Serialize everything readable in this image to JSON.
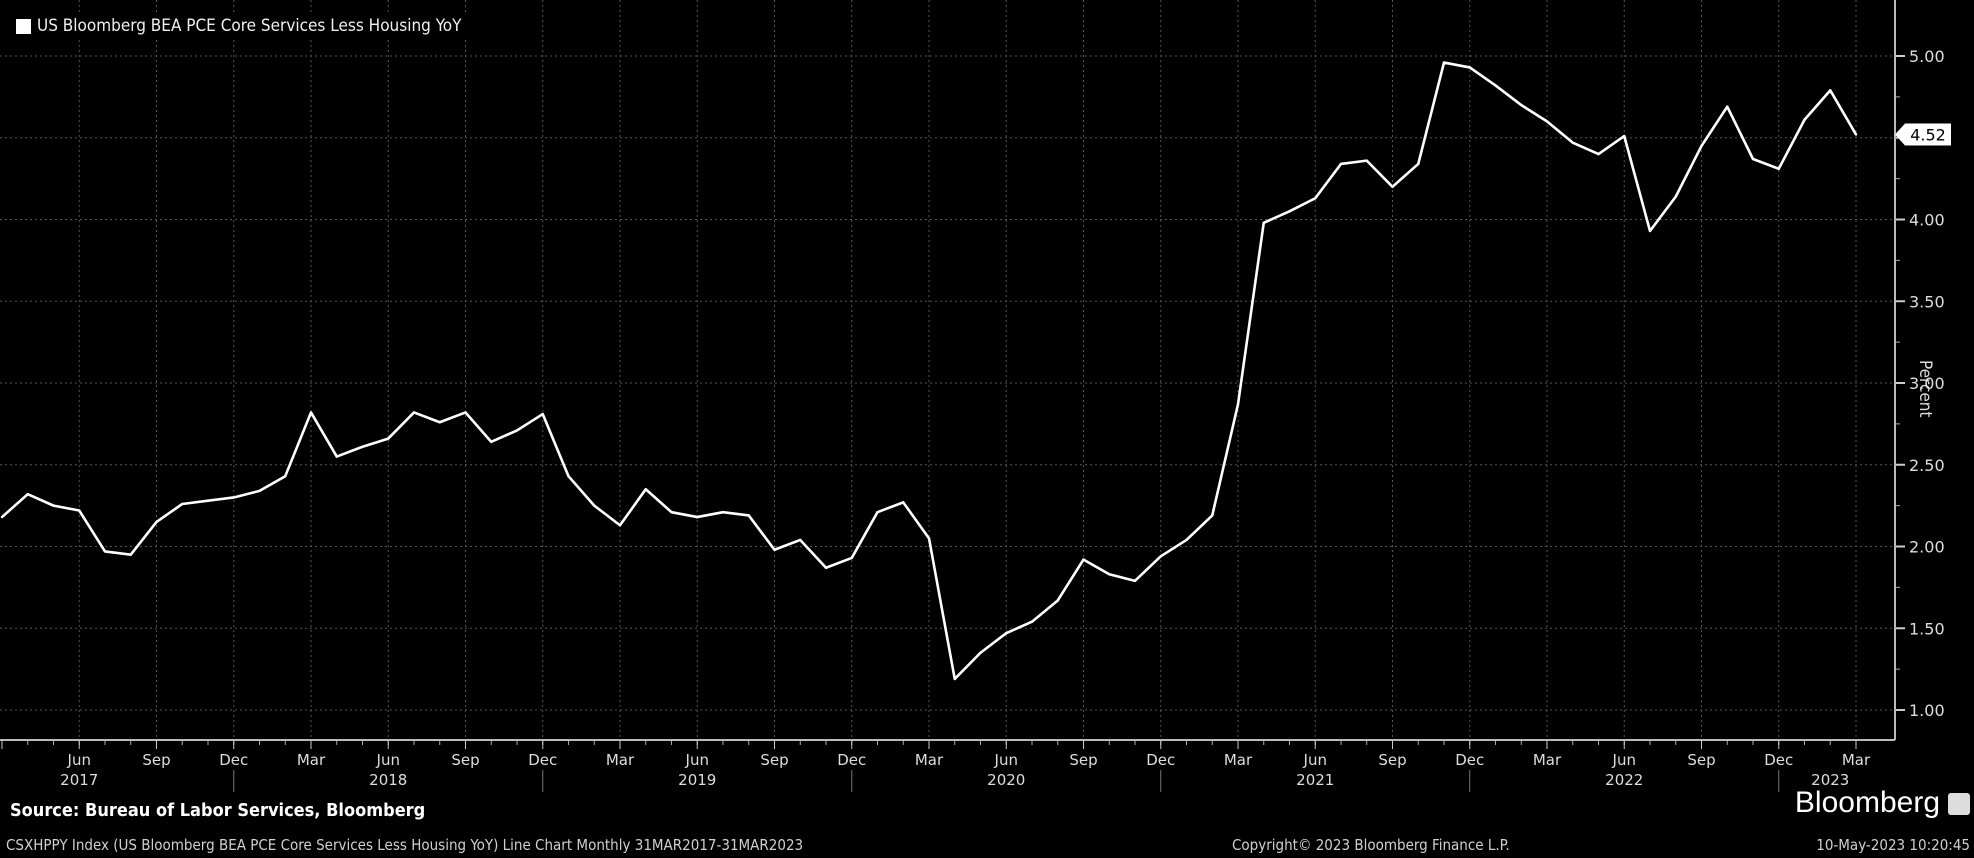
{
  "chart_data": {
    "type": "line",
    "title": "US Bloomberg BEA PCE Core Services Less Housing YoY",
    "ylabel": "Percent",
    "ylim": [
      0.85,
      5.35
    ],
    "yticks": [
      1.0,
      1.5,
      2.0,
      2.5,
      3.0,
      3.5,
      4.0,
      4.5,
      5.0
    ],
    "ytick_labels": [
      "1.00",
      "1.50",
      "2.00",
      "2.50",
      "3.00",
      "3.50",
      "4.00",
      "4.50",
      "5.00"
    ],
    "grid": true,
    "legend": "top-left",
    "x_start": "Mar 2017",
    "x_end": "Mar 2023",
    "frequency": "Monthly",
    "month_labels": [
      "Mar",
      "Jun",
      "Sep",
      "Dec"
    ],
    "year_labels": [
      "2017",
      "2018",
      "2019",
      "2020",
      "2021",
      "2022",
      "2023"
    ],
    "last_value_label": "4.52",
    "series": [
      {
        "name": "US Bloomberg BEA PCE Core Services Less Housing YoY",
        "color": "#ffffff",
        "values": [
          2.18,
          2.32,
          2.25,
          2.22,
          1.97,
          1.95,
          2.15,
          2.26,
          2.28,
          2.3,
          2.34,
          2.43,
          2.82,
          2.55,
          2.61,
          2.66,
          2.82,
          2.76,
          2.82,
          2.64,
          2.71,
          2.81,
          2.43,
          2.25,
          2.13,
          2.35,
          2.21,
          2.18,
          2.21,
          2.19,
          1.98,
          2.04,
          1.87,
          1.93,
          2.21,
          2.27,
          2.05,
          1.19,
          1.35,
          1.47,
          1.54,
          1.67,
          1.92,
          1.83,
          1.79,
          1.94,
          2.04,
          2.19,
          2.87,
          3.98,
          4.05,
          4.13,
          4.34,
          4.36,
          4.2,
          4.34,
          4.96,
          4.93,
          4.82,
          4.7,
          4.6,
          4.47,
          4.4,
          4.51,
          3.93,
          4.14,
          4.45,
          4.69,
          4.37,
          4.31,
          4.61,
          4.79,
          4.52
        ]
      }
    ]
  },
  "legend_label": "US Bloomberg BEA PCE Core Services Less Housing YoY",
  "source": "Source: Bureau of Labor Services, Bloomberg",
  "footer_left": "CSXHPPY Index (US Bloomberg BEA PCE Core Services Less Housing YoY) Line Chart  Monthly 31MAR2017-31MAR2023",
  "footer_center": "Copyright© 2023 Bloomberg Finance L.P.",
  "footer_right": "10-May-2023 10:20:45",
  "brand": "Bloomberg"
}
